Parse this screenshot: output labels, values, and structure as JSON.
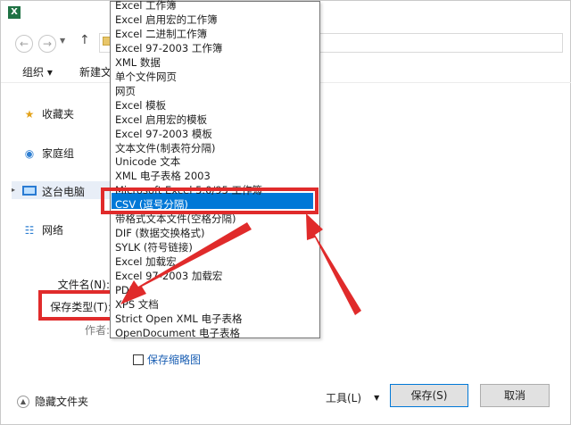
{
  "window": {
    "app_icon_text": "X"
  },
  "nav": {
    "back_icon": "arrow-left",
    "forward_icon": "arrow-right",
    "up_icon": "arrow-up"
  },
  "toolbar": {
    "organize_label": "组织 ▾",
    "new_folder_label": "新建文"
  },
  "sidebar": {
    "items": [
      {
        "label": "收藏夹",
        "icon": "star-icon"
      },
      {
        "label": "家庭组",
        "icon": "homegroup-icon"
      },
      {
        "label": "这台电脑",
        "icon": "computer-icon"
      },
      {
        "label": "网络",
        "icon": "network-icon"
      }
    ]
  },
  "form": {
    "filename_label": "文件名(N):",
    "savetype_label": "保存类型(T):",
    "author_label": "作者:"
  },
  "save_type_options": [
    "Excel 工作簿",
    "Excel 启用宏的工作簿",
    "Excel 二进制工作簿",
    "Excel 97-2003 工作簿",
    "XML 数据",
    "单个文件网页",
    "网页",
    "Excel 模板",
    "Excel 启用宏的模板",
    "Excel 97-2003 模板",
    "文本文件(制表符分隔)",
    "Unicode 文本",
    "XML 电子表格 2003",
    "Microsoft Excel 5.0/95 工作簿",
    "CSV (逗号分隔)",
    "带格式文本文件(空格分隔)",
    "DIF (数据交换格式)",
    "SYLK (符号链接)",
    "Excel 加载宏",
    "Excel 97-2003 加载宏",
    "PDF",
    "XPS 文档",
    "Strict Open XML 电子表格",
    "OpenDocument 电子表格"
  ],
  "selected_option": "CSV (逗号分隔)",
  "thumbnail": {
    "label": "保存缩略图",
    "checked": false
  },
  "footer": {
    "hide_folders_label": "隐藏文件夹",
    "tools_label": "工具(L)",
    "save_label": "保存(S)",
    "cancel_label": "取消"
  },
  "colors": {
    "highlight_red": "#e02b2b",
    "selection_blue": "#0078d7",
    "excel_green": "#1f7244"
  }
}
